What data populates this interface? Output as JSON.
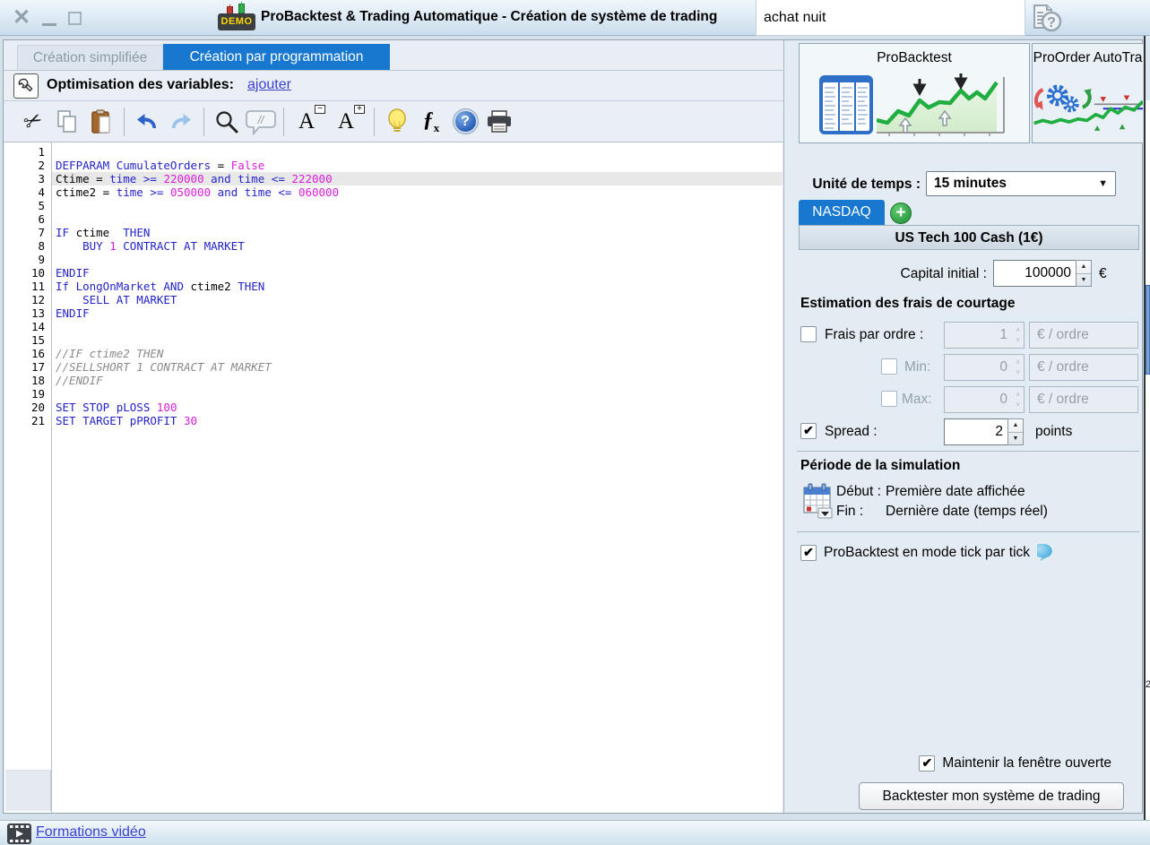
{
  "window": {
    "title": "ProBacktest & Trading Automatique - Création de système de trading",
    "system_name": "achat nuit",
    "demo_badge": "DEMO",
    "controls": [
      "close-icon",
      "minimize-icon",
      "maximize-icon"
    ],
    "help_icon": "document-question-icon"
  },
  "left": {
    "tabs": [
      {
        "label": "Création simplifiée",
        "active": false
      },
      {
        "label": "Création par programmation",
        "active": true
      }
    ],
    "optimization": {
      "label": "Optimisation des variables:",
      "link": "ajouter",
      "icon": "wrench-icon"
    },
    "toolbar_icons": [
      "cut-icon",
      "copy-icon",
      "paste-icon",
      "undo-icon",
      "redo-icon",
      "zoom-icon",
      "comment-icon",
      "font-decrease-icon",
      "font-increase-icon",
      "lightbulb-icon",
      "function-icon",
      "help-icon",
      "print-icon"
    ],
    "comment_glyph": "//",
    "font_glyph": "A",
    "fx_glyph": "ƒ",
    "help_glyph": "?"
  },
  "editor": {
    "lines": [
      {
        "n": 1,
        "segments": []
      },
      {
        "n": 2,
        "segments": [
          {
            "t": "DEFPARAM CumulateOrders",
            "c": "kw"
          },
          {
            "t": " = ",
            "c": "pl"
          },
          {
            "t": "False",
            "c": "num"
          }
        ]
      },
      {
        "n": 3,
        "highlight": true,
        "segments": [
          {
            "t": "Ctime = ",
            "c": "pl"
          },
          {
            "t": "time >= ",
            "c": "kw"
          },
          {
            "t": "220000",
            "c": "num"
          },
          {
            "t": " ",
            "c": "pl"
          },
          {
            "t": "and time <= ",
            "c": "kw"
          },
          {
            "t": "222000",
            "c": "num"
          }
        ]
      },
      {
        "n": 4,
        "segments": [
          {
            "t": "ctime2 = ",
            "c": "pl"
          },
          {
            "t": "time >= ",
            "c": "kw"
          },
          {
            "t": "050000",
            "c": "num"
          },
          {
            "t": " ",
            "c": "pl"
          },
          {
            "t": "and time <= ",
            "c": "kw"
          },
          {
            "t": "060000",
            "c": "num"
          }
        ]
      },
      {
        "n": 5,
        "segments": []
      },
      {
        "n": 6,
        "segments": []
      },
      {
        "n": 7,
        "segments": [
          {
            "t": "IF ",
            "c": "kw"
          },
          {
            "t": "ctime",
            "c": "pl"
          },
          {
            "t": "  THEN",
            "c": "kw"
          }
        ]
      },
      {
        "n": 8,
        "segments": [
          {
            "t": "    BUY ",
            "c": "kw"
          },
          {
            "t": "1",
            "c": "num"
          },
          {
            "t": " CONTRACT AT MARKET",
            "c": "kw"
          }
        ]
      },
      {
        "n": 9,
        "segments": []
      },
      {
        "n": 10,
        "segments": [
          {
            "t": "ENDIF",
            "c": "kw"
          }
        ]
      },
      {
        "n": 11,
        "segments": [
          {
            "t": "If LongOnMarket AND ",
            "c": "kw"
          },
          {
            "t": "ctime2 ",
            "c": "pl"
          },
          {
            "t": "THEN",
            "c": "kw"
          }
        ]
      },
      {
        "n": 12,
        "segments": [
          {
            "t": "    SELL AT MARKET",
            "c": "kw"
          }
        ]
      },
      {
        "n": 13,
        "segments": [
          {
            "t": "ENDIF",
            "c": "kw"
          }
        ]
      },
      {
        "n": 14,
        "segments": []
      },
      {
        "n": 15,
        "segments": []
      },
      {
        "n": 16,
        "segments": [
          {
            "t": "//IF ctime2 THEN",
            "c": "cm"
          }
        ]
      },
      {
        "n": 17,
        "segments": [
          {
            "t": "//SELLSHORT 1 CONTRACT AT MARKET",
            "c": "cm"
          }
        ]
      },
      {
        "n": 18,
        "segments": [
          {
            "t": "//ENDIF",
            "c": "cm"
          }
        ]
      },
      {
        "n": 19,
        "segments": []
      },
      {
        "n": 20,
        "segments": [
          {
            "t": "SET STOP pLOSS ",
            "c": "kw"
          },
          {
            "t": "100",
            "c": "num"
          }
        ]
      },
      {
        "n": 21,
        "segments": [
          {
            "t": "SET TARGET pPROFIT ",
            "c": "kw"
          },
          {
            "t": "30",
            "c": "num"
          }
        ]
      }
    ]
  },
  "right": {
    "panel_tabs": [
      {
        "label": "ProBacktest",
        "active": true,
        "icon": "table-chart-icon"
      },
      {
        "label": "ProOrder AutoTra",
        "active": false,
        "icon": "gears-chart-icon"
      }
    ],
    "timeframe_label": "Unité de temps :",
    "timeframe_value": "15 minutes",
    "market_tab": "NASDAQ",
    "add_market_icon": "plus-icon",
    "instrument_header": "US Tech 100 Cash (1€)",
    "capital_label": "Capital initial :",
    "capital_value": "100000",
    "capital_unit": "€",
    "fees_title": "Estimation des frais de courtage",
    "fees_rows": [
      {
        "label": "Frais par ordre :",
        "checked": false,
        "value": "1",
        "unit": "€ / ordre"
      },
      {
        "label": "Min:",
        "checked": false,
        "value": "0",
        "unit": "€ / ordre"
      },
      {
        "label": "Max:",
        "checked": false,
        "value": "0",
        "unit": "€ / ordre"
      },
      {
        "label": "Spread :",
        "checked": true,
        "value": "2",
        "unit": "points"
      }
    ],
    "period_title": "Période de la simulation",
    "period_icon": "calendar-icon",
    "period_start_label": "Début :",
    "period_start_value": "Première date affichée",
    "period_end_label": "Fin :",
    "period_end_value": "Dernière date (temps réel)",
    "tick_label": "ProBacktest en mode tick par tick",
    "tick_checked": true,
    "tick_icon": "speech-bubble-icon",
    "keep_open_label": "Maintenir la fenêtre ouverte",
    "keep_open_checked": true,
    "backtest_button": "Backtester mon système de trading"
  },
  "footer": {
    "video_link": "Formations vidéo",
    "icon": "film-icon"
  },
  "background_edge": {
    "fragment": "2"
  }
}
